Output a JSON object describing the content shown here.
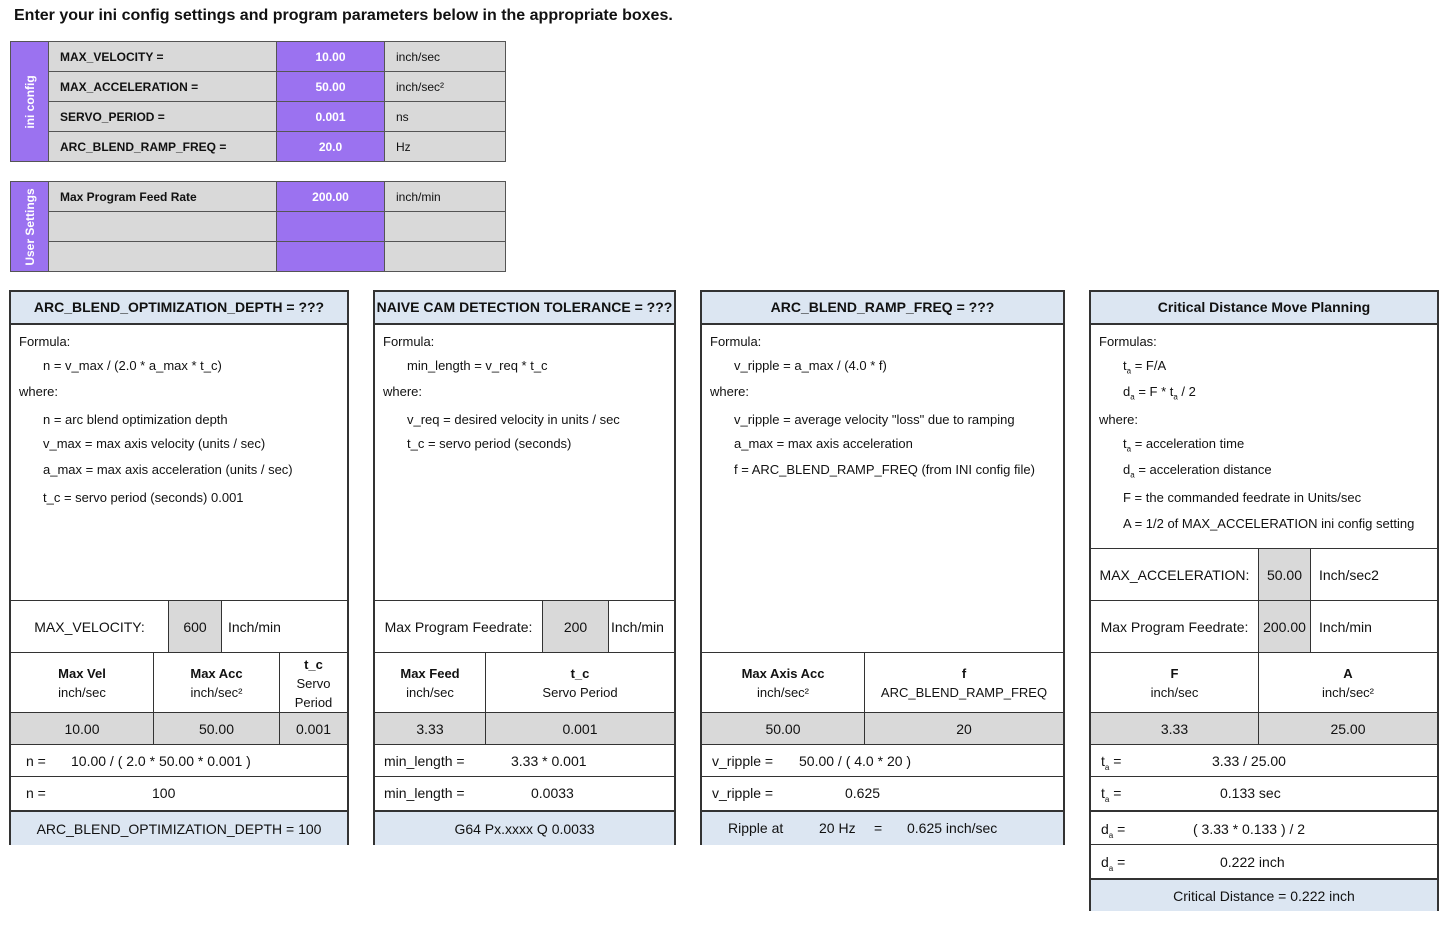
{
  "heading": "Enter your ini config settings and program parameters below in the appropriate boxes.",
  "ini": {
    "side_label": "ini config",
    "rows": [
      {
        "label": "MAX_VELOCITY =",
        "value": "10.00",
        "unit": "inch/sec"
      },
      {
        "label": "MAX_ACCELERATION =",
        "value": "50.00",
        "unit": "inch/sec²"
      },
      {
        "label": "SERVO_PERIOD =",
        "value": "0.001",
        "unit": "ns"
      },
      {
        "label": "ARC_BLEND_RAMP_FREQ =",
        "value": "20.0",
        "unit": "Hz"
      }
    ]
  },
  "user": {
    "side_label": "User Settings",
    "rows": [
      {
        "label": "Max Program Feed Rate",
        "value": "200.00",
        "unit": "inch/min"
      },
      {
        "label": "",
        "value": "",
        "unit": ""
      },
      {
        "label": "",
        "value": "",
        "unit": ""
      }
    ]
  },
  "p1": {
    "title": "ARC_BLEND_OPTIMIZATION_DEPTH = ???",
    "formula_label": "Formula:",
    "formula": "n  =  v_max / (2.0  *  a_max * t_c)",
    "where": "where:",
    "defs": [
      "n  =  arc blend optimization depth",
      "v_max  =  max axis velocity (units / sec)",
      "a_max  =  max axis acceleration (units / sec)",
      "t_c  =  servo period (seconds) 0.001"
    ],
    "input_label": "MAX_VELOCITY:",
    "input_value": "600",
    "input_unit": "Inch/min",
    "col1_head": "Max Vel",
    "col1_unit": "inch/sec",
    "col2_head": "Max Acc",
    "col2_unit": "inch/sec²",
    "col3_head": "t_c",
    "col3_sub1": "Servo",
    "col3_sub2": "Period",
    "v1": "10.00",
    "v2": "50.00",
    "v3": "0.001",
    "calc1_label": "n =",
    "calc1": "10.00  / ( 2.0  *  50.00  *   0.001  )",
    "calc2_label": "n =",
    "calc2": "100",
    "result": "ARC_BLEND_OPTIMIZATION_DEPTH = 100"
  },
  "p2": {
    "title": "NAIVE CAM DETECTION TOLERANCE  = ???",
    "formula_label": "Formula:",
    "formula": "min_length  =  v_req * t_c",
    "where": "where:",
    "defs": [
      "v_req  =  desired velocity in units / sec",
      "t_c  =  servo period (seconds)"
    ],
    "input_label": "Max Program Feedrate:",
    "input_value": "200",
    "input_unit": "Inch/min",
    "col1_head": "Max Feed",
    "col1_unit": "inch/sec",
    "col2_head": "t_c",
    "col2_unit": "Servo Period",
    "v1": "3.33",
    "v2": "0.001",
    "calc1_label": "min_length =",
    "calc1": "3.33  *  0.001",
    "calc2_label": "min_length =",
    "calc2": "0.0033",
    "result": "G64  Px.xxxx  Q 0.0033"
  },
  "p3": {
    "title": "ARC_BLEND_RAMP_FREQ = ???",
    "formula_label": "Formula:",
    "formula": "v_ripple  =  a_max / (4.0 * f)",
    "where": "where:",
    "defs": [
      "v_ripple  =  average velocity \"loss\" due to ramping",
      "a_max  =  max axis acceleration",
      "f  =  ARC_BLEND_RAMP_FREQ  (from INI config file)"
    ],
    "col1_head": "Max Axis Acc",
    "col1_unit": "inch/sec²",
    "col2_head": "f",
    "col2_unit": "ARC_BLEND_RAMP_FREQ",
    "v1": "50.00",
    "v2": "20",
    "calc1_label": "v_ripple =",
    "calc1": "50.00  /  ( 4.0  *    20  )",
    "calc2_label": "v_ripple =",
    "calc2": "0.625",
    "result_a": "Ripple at",
    "result_b": "20 Hz",
    "result_c": "=",
    "result_d": "0.625 inch/sec"
  },
  "p4": {
    "title": "Critical Distance Move Planning",
    "formula_label": "Formulas:",
    "f1": "= F/A",
    "f2": "= F * t",
    "f2b": " / 2",
    "where": "where:",
    "def1": "=  acceleration time",
    "def2": "=  acceleration distance",
    "def3": "F  =  the commanded feedrate in Units/sec",
    "def4": "A  =  1/2 of MAX_ACCELERATION ini config setting",
    "in1_label": "MAX_ACCELERATION:",
    "in1_value": "50.00",
    "in1_unit": "Inch/sec2",
    "in2_label": "Max Program Feedrate:",
    "in2_value": "200.00",
    "in2_unit": "Inch/min",
    "col1_head": "F",
    "col1_unit": "inch/sec",
    "col2_head": "A",
    "col2_unit": "inch/sec²",
    "v1": "3.33",
    "v2": "25.00",
    "calc1": "3.33  /  25.00",
    "calc2": "0.133   sec",
    "calc3": "( 3.33    *  0.133 )  / 2",
    "calc4": "0.222    inch",
    "result": "Critical Distance  =    0.222    inch",
    "ta_sym": "t",
    "da_sym": "d",
    "a_sub": "a",
    "eq": "="
  }
}
